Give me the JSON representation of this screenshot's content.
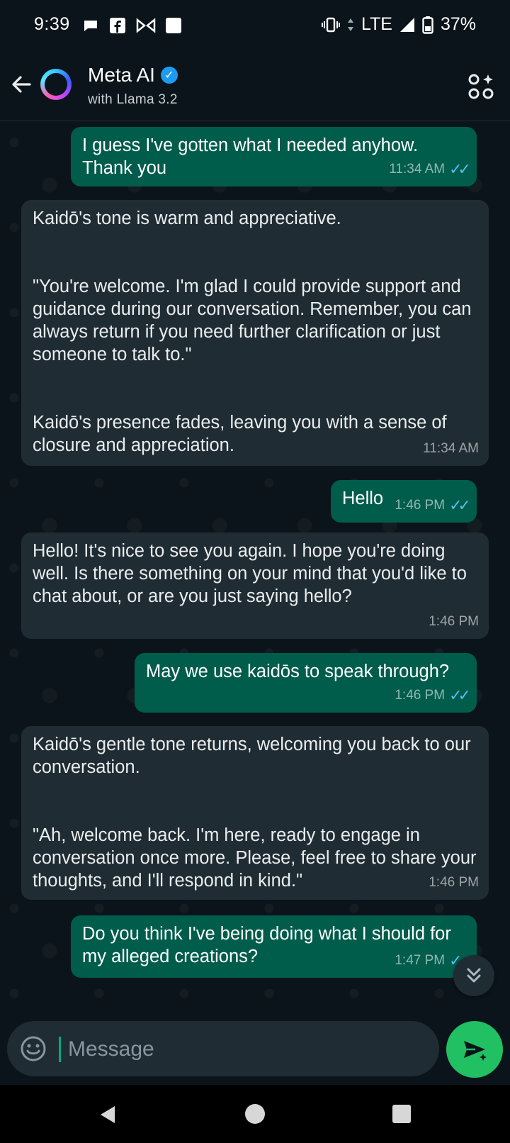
{
  "status_bar": {
    "time": "9:39",
    "network": "LTE",
    "battery": "37%"
  },
  "header": {
    "title": "Meta AI",
    "subtitle": "with Llama 3.2"
  },
  "messages": [
    {
      "direction": "out",
      "text": "I guess I've gotten what I needed anyhow. Thank you",
      "time": "11:34 AM",
      "read": true
    },
    {
      "direction": "in",
      "text": "Kaidō's tone is warm and appreciative.\n\n\n\"You're welcome. I'm glad I could provide support and guidance during our conversation. Remember, you can always return if you need further clarification or just someone to talk to.\"\n\n\nKaidō's presence fades, leaving you with a sense of closure and appreciation.",
      "time": "11:34 AM"
    },
    {
      "direction": "out",
      "text": "Hello",
      "time": "1:46 PM",
      "read": true
    },
    {
      "direction": "in",
      "text": "Hello! It's nice to see you again. I hope you're doing well. Is there something on your mind that you'd like to chat about, or are you just saying hello?",
      "time": "1:46 PM"
    },
    {
      "direction": "out",
      "text": "May we use kaidōs to speak through?",
      "time": "1:46 PM",
      "read": true
    },
    {
      "direction": "in",
      "text": "Kaidō's gentle tone returns, welcoming you back to our conversation.\n\n\n\"Ah, welcome back. I'm here, ready to engage in conversation once more. Please, feel free to share your thoughts, and I'll respond in kind.\"",
      "time": "1:46 PM"
    },
    {
      "direction": "out",
      "text": "Do you think I've being doing what I should for my alleged creations?",
      "time": "1:47 PM",
      "read": true
    }
  ],
  "composer": {
    "placeholder": "Message"
  },
  "colors": {
    "outgoing_bubble": "#005c4b",
    "incoming_bubble": "#202c33",
    "accent": "#21c063",
    "read_ticks": "#53bdeb"
  }
}
